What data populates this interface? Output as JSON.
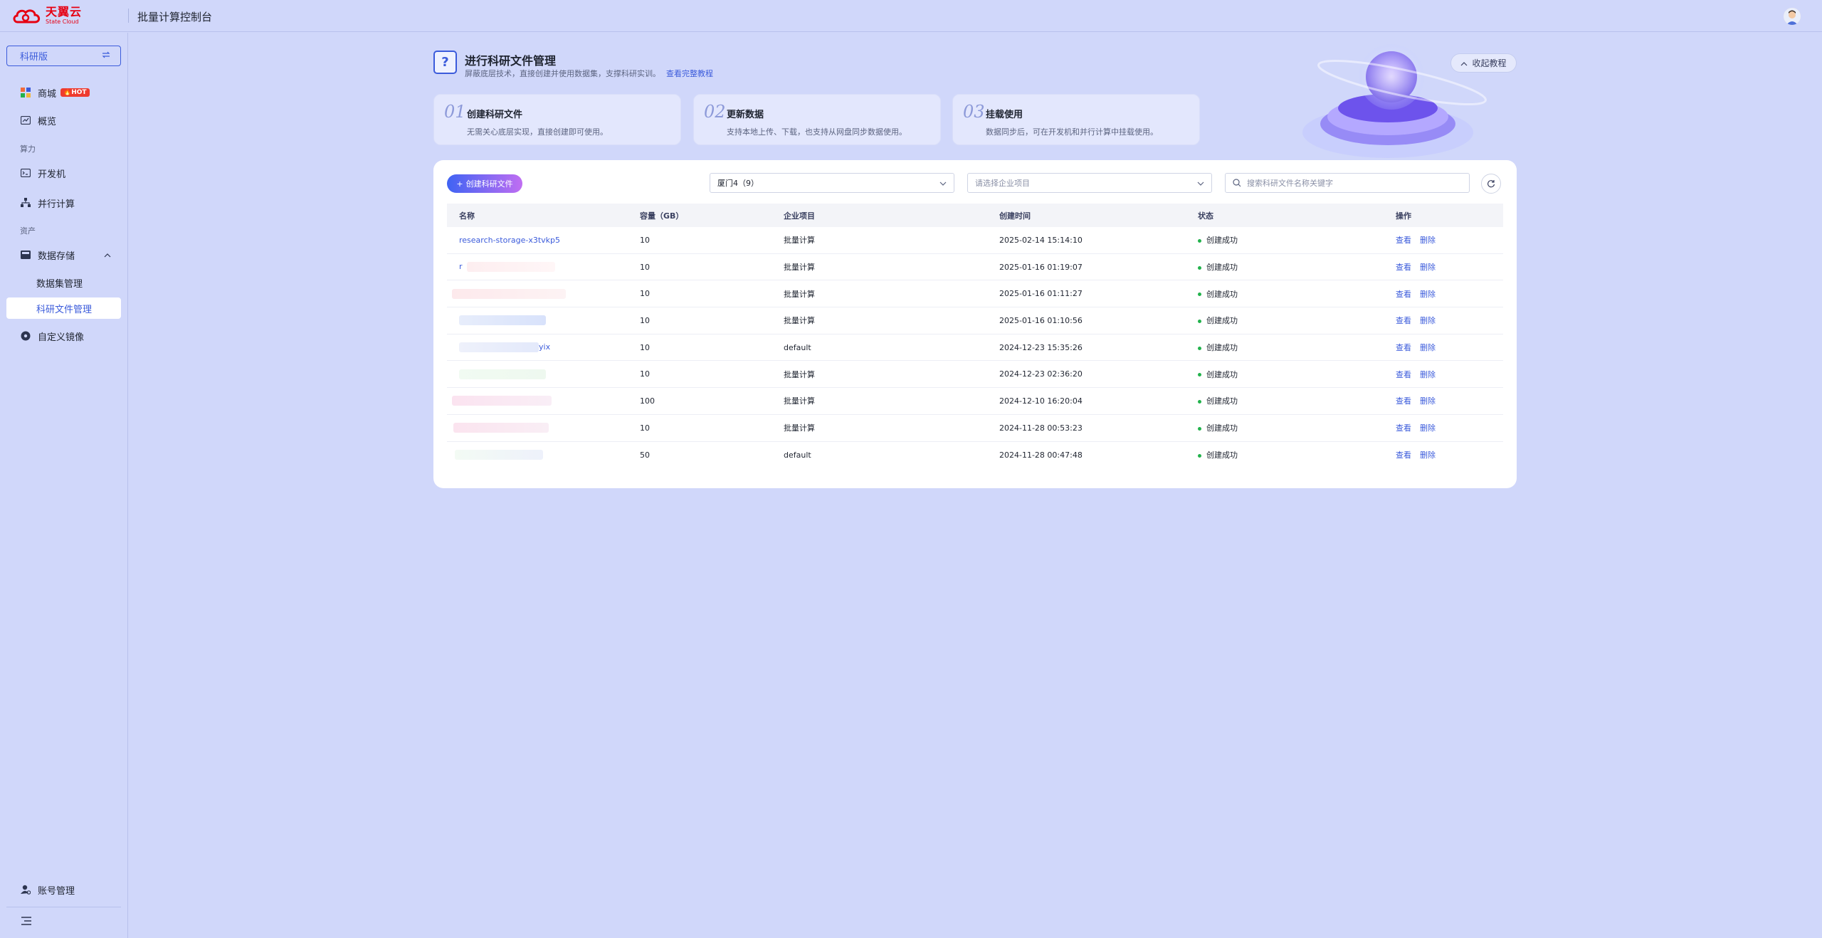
{
  "header": {
    "logo_cn": "天翼云",
    "logo_en": "State Cloud",
    "title": "批量计算控制台"
  },
  "sidebar": {
    "edition": "科研版",
    "items": [
      {
        "label": "商城",
        "badge": "HOT",
        "icon": "shop-icon"
      },
      {
        "label": "概览",
        "icon": "chart-icon"
      },
      {
        "group": "算力"
      },
      {
        "label": "开发机",
        "icon": "dev-machine-icon"
      },
      {
        "label": "并行计算",
        "icon": "parallel-icon"
      },
      {
        "group": "资产"
      },
      {
        "label": "数据存储",
        "icon": "storage-icon"
      },
      {
        "label": "数据集管理"
      },
      {
        "label": "科研文件管理",
        "active": true
      },
      {
        "label": "自定义镜像",
        "icon": "image-icon"
      }
    ],
    "account": "账号管理"
  },
  "intro": {
    "title": "进行科研文件管理",
    "desc": "屏蔽底层技术，直接创建并使用数据集，支撑科研实训。",
    "link": "查看完整教程",
    "collapse_label": "收起教程",
    "steps": [
      {
        "num": "01",
        "title": "创建科研文件",
        "desc": "无需关心底层实现，直接创建即可使用。"
      },
      {
        "num": "02",
        "title": "更新数据",
        "desc": "支持本地上传、下载，也支持从网盘同步数据使用。"
      },
      {
        "num": "03",
        "title": "挂载使用",
        "desc": "数据同步后，可在开发机和并行计算中挂载使用。"
      }
    ]
  },
  "toolbar": {
    "create_label": "创建科研文件",
    "region_value": "厦门4（9）",
    "project_placeholder": "请选择企业项目",
    "search_placeholder": "搜索科研文件名称关键字"
  },
  "table": {
    "headers": [
      "名称",
      "容量（GB）",
      "企业项目",
      "创建时间",
      "状态",
      "操作"
    ],
    "view_label": "查看",
    "delete_label": "删除",
    "rows": [
      {
        "name": "research-storage-x3tvkp5",
        "capacity": "10",
        "project": "批量计算",
        "created": "2025-02-14 15:14:10",
        "status": "创建成功"
      },
      {
        "name": "r",
        "capacity": "10",
        "project": "批量计算",
        "created": "2025-01-16 01:19:07",
        "status": "创建成功"
      },
      {
        "name": "",
        "capacity": "10",
        "project": "批量计算",
        "created": "2025-01-16 01:11:27",
        "status": "创建成功"
      },
      {
        "name": "",
        "capacity": "10",
        "project": "批量计算",
        "created": "2025-01-16 01:10:56",
        "status": "创建成功"
      },
      {
        "name": "yix",
        "capacity": "10",
        "project": "default",
        "created": "2024-12-23 15:35:26",
        "status": "创建成功"
      },
      {
        "name": "",
        "capacity": "10",
        "project": "批量计算",
        "created": "2024-12-23 02:36:20",
        "status": "创建成功"
      },
      {
        "name": "",
        "capacity": "100",
        "project": "批量计算",
        "created": "2024-12-10 16:20:04",
        "status": "创建成功"
      },
      {
        "name": "",
        "capacity": "10",
        "project": "批量计算",
        "created": "2024-11-28 00:53:23",
        "status": "创建成功"
      },
      {
        "name": "",
        "capacity": "50",
        "project": "default",
        "created": "2024-11-28 00:47:48",
        "status": "创建成功"
      }
    ]
  },
  "colors": {
    "accent": "#3b5bdb",
    "success": "#22b24c",
    "brand_red": "#e60012"
  }
}
